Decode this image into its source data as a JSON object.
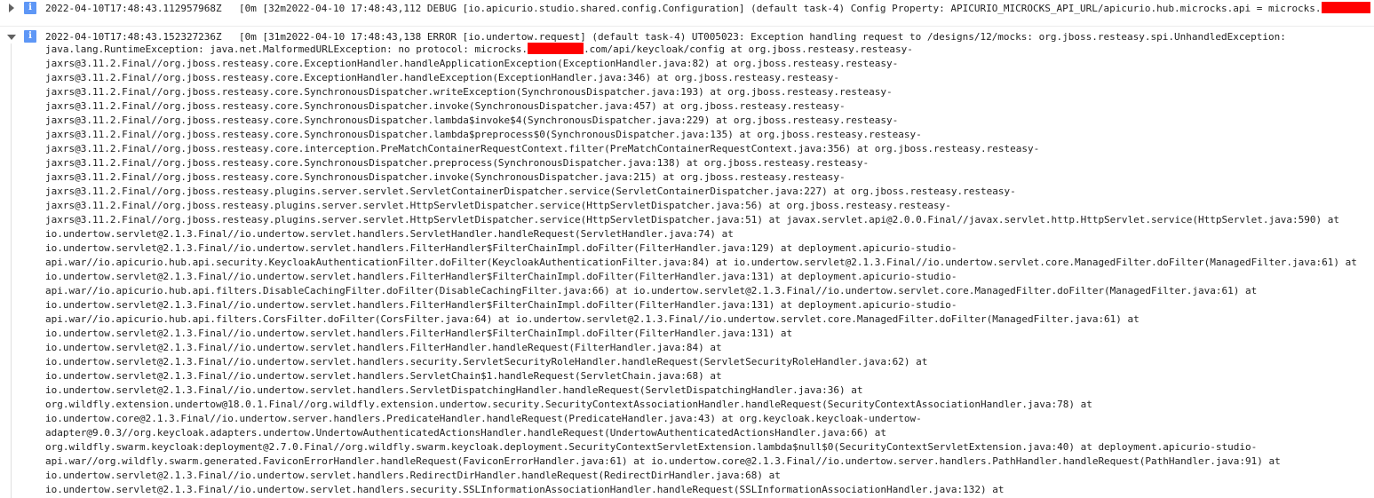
{
  "entries": [
    {
      "severity_icon": "info-icon",
      "severity_glyph": "i",
      "expanded": false,
      "timestamp": "2022-04-10T17:48:43.112957968Z",
      "summary_text": "[0m [32m2022-04-10 17:48:43,112 DEBUG [io.apicurio.studio.shared.config.Configuration] (default task-4) Config Property: APICURIO_MICROCKS_API_URL/apicurio.hub.microcks.api = microcks."
    },
    {
      "severity_icon": "info-icon",
      "severity_glyph": "i",
      "expanded": true,
      "timestamp": "2022-04-10T17:48:43.152327236Z",
      "summary_text": "[0m [31m2022-04-10 17:48:43,138 ERROR [io.undertow.request] (default task-4) UT005023: Exception handling request to /designs/12/mocks: org.jboss.resteasy.spi.UnhandledException:",
      "first_line_before": "java.lang.RuntimeException: java.net.MalformedURLException: no protocol: microcks.",
      "first_line_after": ".com/api/keycloak/config at org.jboss.resteasy.resteasy-",
      "lines": [
        "jaxrs@3.11.2.Final//org.jboss.resteasy.core.ExceptionHandler.handleApplicationException(ExceptionHandler.java:82) at org.jboss.resteasy.resteasy-",
        "jaxrs@3.11.2.Final//org.jboss.resteasy.core.ExceptionHandler.handleException(ExceptionHandler.java:346) at org.jboss.resteasy.resteasy-",
        "jaxrs@3.11.2.Final//org.jboss.resteasy.core.SynchronousDispatcher.writeException(SynchronousDispatcher.java:193) at org.jboss.resteasy.resteasy-",
        "jaxrs@3.11.2.Final//org.jboss.resteasy.core.SynchronousDispatcher.invoke(SynchronousDispatcher.java:457) at org.jboss.resteasy.resteasy-",
        "jaxrs@3.11.2.Final//org.jboss.resteasy.core.SynchronousDispatcher.lambda$invoke$4(SynchronousDispatcher.java:229) at org.jboss.resteasy.resteasy-",
        "jaxrs@3.11.2.Final//org.jboss.resteasy.core.SynchronousDispatcher.lambda$preprocess$0(SynchronousDispatcher.java:135) at org.jboss.resteasy.resteasy-",
        "jaxrs@3.11.2.Final//org.jboss.resteasy.core.interception.PreMatchContainerRequestContext.filter(PreMatchContainerRequestContext.java:356) at org.jboss.resteasy.resteasy-",
        "jaxrs@3.11.2.Final//org.jboss.resteasy.core.SynchronousDispatcher.preprocess(SynchronousDispatcher.java:138) at org.jboss.resteasy.resteasy-",
        "jaxrs@3.11.2.Final//org.jboss.resteasy.core.SynchronousDispatcher.invoke(SynchronousDispatcher.java:215) at org.jboss.resteasy.resteasy-",
        "jaxrs@3.11.2.Final//org.jboss.resteasy.plugins.server.servlet.ServletContainerDispatcher.service(ServletContainerDispatcher.java:227) at org.jboss.resteasy.resteasy-",
        "jaxrs@3.11.2.Final//org.jboss.resteasy.plugins.server.servlet.HttpServletDispatcher.service(HttpServletDispatcher.java:56) at org.jboss.resteasy.resteasy-",
        "jaxrs@3.11.2.Final//org.jboss.resteasy.plugins.server.servlet.HttpServletDispatcher.service(HttpServletDispatcher.java:51) at javax.servlet.api@2.0.0.Final//javax.servlet.http.HttpServlet.service(HttpServlet.java:590) at",
        "io.undertow.servlet@2.1.3.Final//io.undertow.servlet.handlers.ServletHandler.handleRequest(ServletHandler.java:74) at",
        "io.undertow.servlet@2.1.3.Final//io.undertow.servlet.handlers.FilterHandler$FilterChainImpl.doFilter(FilterHandler.java:129) at deployment.apicurio-studio-",
        "api.war//io.apicurio.hub.api.security.KeycloakAuthenticationFilter.doFilter(KeycloakAuthenticationFilter.java:84) at io.undertow.servlet@2.1.3.Final//io.undertow.servlet.core.ManagedFilter.doFilter(ManagedFilter.java:61) at",
        "io.undertow.servlet@2.1.3.Final//io.undertow.servlet.handlers.FilterHandler$FilterChainImpl.doFilter(FilterHandler.java:131) at deployment.apicurio-studio-",
        "api.war//io.apicurio.hub.api.filters.DisableCachingFilter.doFilter(DisableCachingFilter.java:66) at io.undertow.servlet@2.1.3.Final//io.undertow.servlet.core.ManagedFilter.doFilter(ManagedFilter.java:61) at",
        "io.undertow.servlet@2.1.3.Final//io.undertow.servlet.handlers.FilterHandler$FilterChainImpl.doFilter(FilterHandler.java:131) at deployment.apicurio-studio-",
        "api.war//io.apicurio.hub.api.filters.CorsFilter.doFilter(CorsFilter.java:64) at io.undertow.servlet@2.1.3.Final//io.undertow.servlet.core.ManagedFilter.doFilter(ManagedFilter.java:61) at",
        "io.undertow.servlet@2.1.3.Final//io.undertow.servlet.handlers.FilterHandler$FilterChainImpl.doFilter(FilterHandler.java:131) at",
        "io.undertow.servlet@2.1.3.Final//io.undertow.servlet.handlers.FilterHandler.handleRequest(FilterHandler.java:84) at",
        "io.undertow.servlet@2.1.3.Final//io.undertow.servlet.handlers.security.ServletSecurityRoleHandler.handleRequest(ServletSecurityRoleHandler.java:62) at",
        "io.undertow.servlet@2.1.3.Final//io.undertow.servlet.handlers.ServletChain$1.handleRequest(ServletChain.java:68) at",
        "io.undertow.servlet@2.1.3.Final//io.undertow.servlet.handlers.ServletDispatchingHandler.handleRequest(ServletDispatchingHandler.java:36) at",
        "org.wildfly.extension.undertow@18.0.1.Final//org.wildfly.extension.undertow.security.SecurityContextAssociationHandler.handleRequest(SecurityContextAssociationHandler.java:78) at",
        "io.undertow.core@2.1.3.Final//io.undertow.server.handlers.PredicateHandler.handleRequest(PredicateHandler.java:43) at org.keycloak.keycloak-undertow-",
        "adapter@9.0.3//org.keycloak.adapters.undertow.UndertowAuthenticatedActionsHandler.handleRequest(UndertowAuthenticatedActionsHandler.java:66) at",
        "org.wildfly.swarm.keycloak:deployment@2.7.0.Final//org.wildfly.swarm.keycloak.deployment.SecurityContextServletExtension.lambda$null$0(SecurityContextServletExtension.java:40) at deployment.apicurio-studio-",
        "api.war//org.wildfly.swarm.generated.FaviconErrorHandler.handleRequest(FaviconErrorHandler.java:61) at io.undertow.core@2.1.3.Final//io.undertow.server.handlers.PathHandler.handleRequest(PathHandler.java:91) at",
        "io.undertow.servlet@2.1.3.Final//io.undertow.servlet.handlers.RedirectDirHandler.handleRequest(RedirectDirHandler.java:68) at",
        "io.undertow.servlet@2.1.3.Final//io.undertow.servlet.handlers.security.SSLInformationAssociationHandler.handleRequest(SSLInformationAssociationHandler.java:132) at"
      ]
    }
  ],
  "colors": {
    "severity_info": "#5e97f6",
    "redaction": "#ff0000",
    "text": "#212121"
  }
}
